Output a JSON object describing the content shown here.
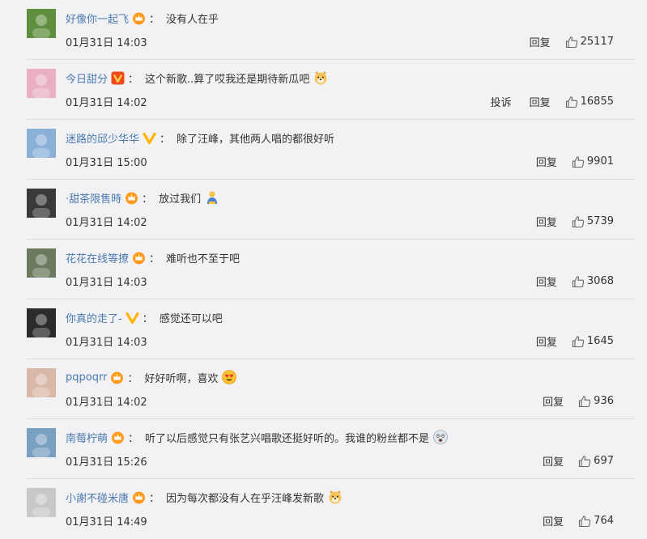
{
  "comments": [
    {
      "user": "好像你一起飞",
      "badge": "crown",
      "text": "没有人在乎",
      "emoji": "",
      "time": "01月31日 14:03",
      "report": "",
      "reply": "回复",
      "likes": "25117",
      "avatar_color": "#5f8f3e"
    },
    {
      "user": "今日甜分",
      "badge": "v-red",
      "text": "这个新歌..算了哎我还是期待新瓜吧",
      "emoji": "dog-face-emoji",
      "time": "01月31日 14:02",
      "report": "投诉",
      "reply": "回复",
      "likes": "16855",
      "avatar_color": "#e8b0c0"
    },
    {
      "user": "迷路的邱少华华",
      "badge": "v-yellow",
      "text": "除了汪峰，其他两人唱的都很好听",
      "emoji": "",
      "time": "01月31日 15:00",
      "report": "",
      "reply": "回复",
      "likes": "9901",
      "avatar_color": "#8ab0d8"
    },
    {
      "user": "·甜茶限售時",
      "badge": "crown",
      "text": "放过我们",
      "emoji": "bowing-person-emoji",
      "time": "01月31日 14:02",
      "report": "",
      "reply": "回复",
      "likes": "5739",
      "avatar_color": "#3a3a3a"
    },
    {
      "user": "花花在线等撩",
      "badge": "crown",
      "text": "难听也不至于吧",
      "emoji": "",
      "time": "01月31日 14:03",
      "report": "",
      "reply": "回复",
      "likes": "3068",
      "avatar_color": "#6b7a5e"
    },
    {
      "user": "你真的走了-",
      "badge": "v-yellow",
      "text": "感觉还可以吧",
      "emoji": "",
      "time": "01月31日 14:03",
      "report": "",
      "reply": "回复",
      "likes": "1645",
      "avatar_color": "#2b2b2b"
    },
    {
      "user": "pqpoqrr",
      "badge": "crown",
      "text": "好好听啊，喜欢",
      "emoji": "heart-eyes-emoji",
      "time": "01月31日 14:02",
      "report": "",
      "reply": "回复",
      "likes": "936",
      "avatar_color": "#d9b8a8"
    },
    {
      "user": "南莓柠萌",
      "badge": "crown",
      "text": "听了以后感觉只有张艺兴唱歌还挺好听的。我谁的粉丝都不是",
      "emoji": "scared-face-emoji",
      "time": "01月31日 15:26",
      "report": "",
      "reply": "回复",
      "likes": "697",
      "avatar_color": "#7aa0c0"
    },
    {
      "user": "小謝不碰米唐",
      "badge": "crown",
      "text": "因为每次都没有人在乎汪峰发新歌",
      "emoji": "dog-face-emoji",
      "time": "01月31日 14:49",
      "report": "",
      "reply": "回复",
      "likes": "764",
      "avatar_color": "#c8c8c8"
    }
  ]
}
